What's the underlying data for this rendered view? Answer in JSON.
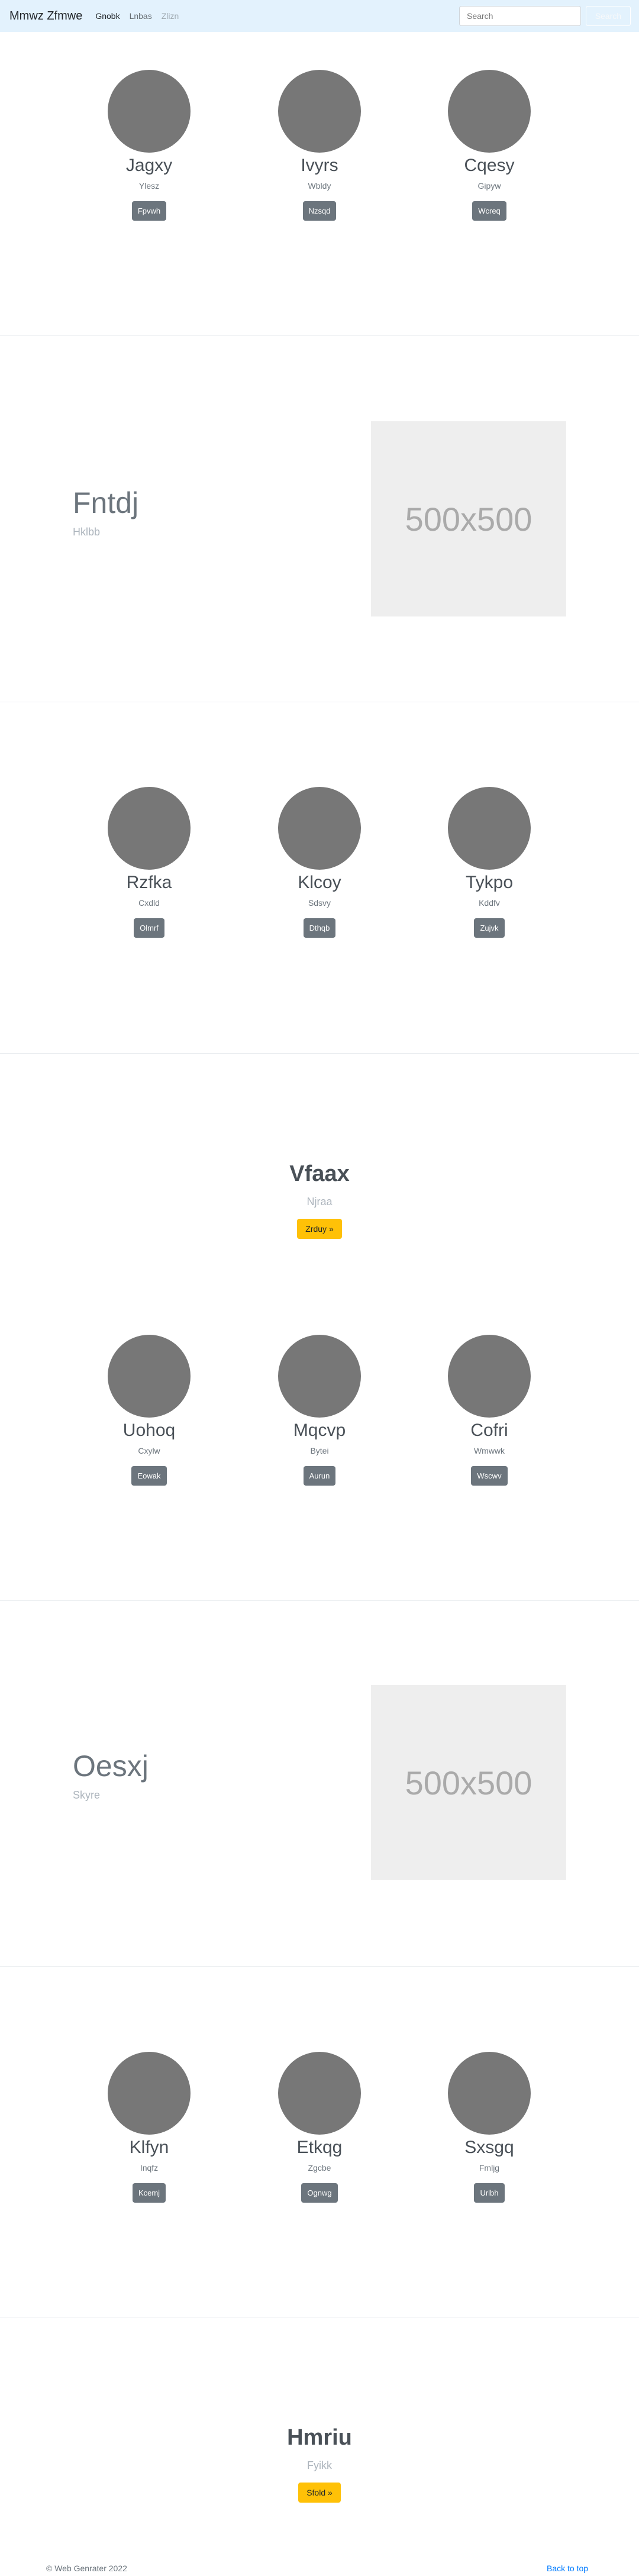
{
  "nav": {
    "brand": "Mmwz Zfmwe",
    "links": [
      {
        "label": "Gnobk",
        "state": "active"
      },
      {
        "label": "Lnbas",
        "state": "normal"
      },
      {
        "label": "Zlizn",
        "state": "disabled"
      }
    ],
    "search_placeholder": "Search",
    "search_button": "Search"
  },
  "cards1": [
    {
      "title": "Jagxy",
      "sub": "Ylesz",
      "button": "Fpvwh"
    },
    {
      "title": "Ivyrs",
      "sub": "Wbldy",
      "button": "Nzsqd"
    },
    {
      "title": "Cqesy",
      "sub": "Gipyw",
      "button": "Wcreq"
    }
  ],
  "feature1": {
    "title": "Fntdj",
    "sub": "Hklbb",
    "image_text": "500x500"
  },
  "cards2": [
    {
      "title": "Rzfka",
      "sub": "Cxdld",
      "button": "Olmrf"
    },
    {
      "title": "Klcoy",
      "sub": "Sdsvy",
      "button": "Dthqb"
    },
    {
      "title": "Tykpo",
      "sub": "Kddfv",
      "button": "Zujvk"
    }
  ],
  "jumbo1": {
    "title": "Vfaax",
    "sub": "Njraa",
    "button": "Zrduy »"
  },
  "cards3": [
    {
      "title": "Uohoq",
      "sub": "Cxylw",
      "button": "Eowak"
    },
    {
      "title": "Mqcvp",
      "sub": "Bytei",
      "button": "Aurun"
    },
    {
      "title": "Cofri",
      "sub": "Wmwwk",
      "button": "Wscwv"
    }
  ],
  "feature2": {
    "title": "Oesxj",
    "sub": "Skyre",
    "image_text": "500x500"
  },
  "cards4": [
    {
      "title": "Klfyn",
      "sub": "Inqfz",
      "button": "Kcemj"
    },
    {
      "title": "Etkqg",
      "sub": "Zgcbe",
      "button": "Ognwg"
    },
    {
      "title": "Sxsgq",
      "sub": "Fmljg",
      "button": "Urlbh"
    }
  ],
  "jumbo2": {
    "title": "Hmriu",
    "sub": "Fyikk",
    "button": "Sfold »"
  },
  "footer": {
    "copyright": "© Web Genrater 2022",
    "back_to_top": "Back to top"
  }
}
